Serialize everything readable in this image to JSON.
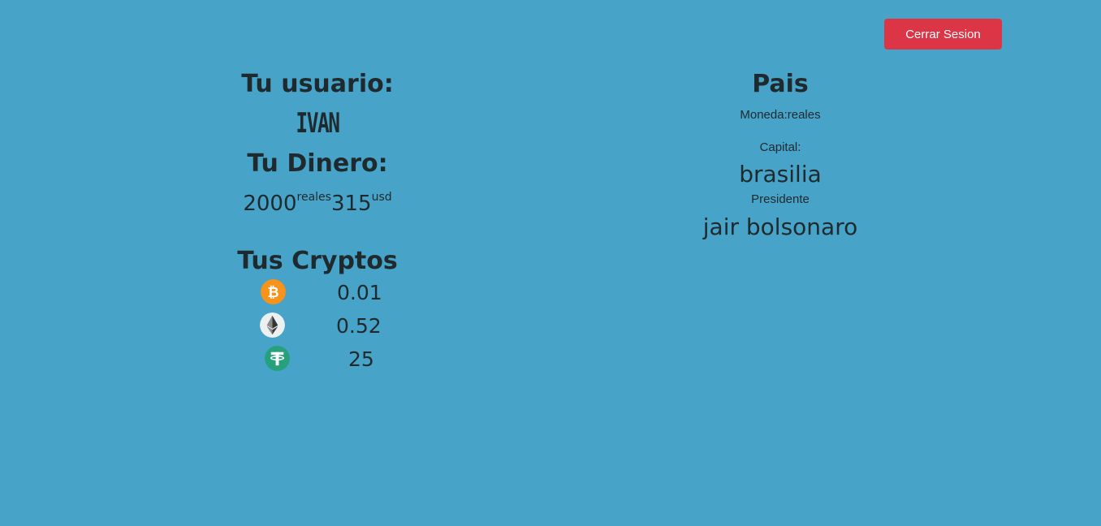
{
  "header": {
    "logout_label": "Cerrar Sesion"
  },
  "user": {
    "title": "Tu usuario:",
    "name": "IVAN",
    "money_title": "Tu Dinero:",
    "money": [
      {
        "amount": "2000",
        "currency": "reales"
      },
      {
        "amount": "315",
        "currency": "usd"
      }
    ]
  },
  "cryptos": {
    "title": "Tus Cryptos",
    "items": [
      {
        "icon": "bitcoin-icon",
        "amount": "0.01",
        "color": "#f7931a"
      },
      {
        "icon": "ethereum-icon",
        "amount": "0.52",
        "color": "#ecf0f1"
      },
      {
        "icon": "tether-icon",
        "amount": "25",
        "color": "#26a17b"
      }
    ]
  },
  "country": {
    "title": "Pais",
    "currency_label": "Moneda:reales",
    "capital_label": "Capital:",
    "capital_value": "brasilia",
    "president_label": "Presidente",
    "president_value": "jair bolsonaro"
  }
}
